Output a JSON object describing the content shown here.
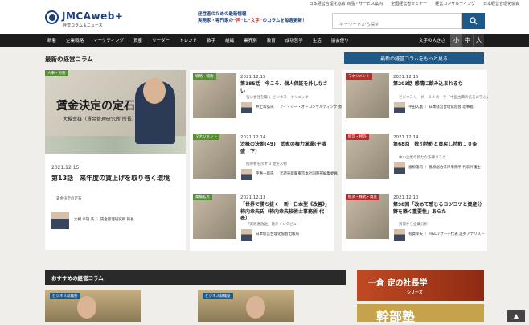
{
  "top_links": [
    "日本経営合理化協会 商品・サービス案内",
    "全国経営者セミナー",
    "経営コンサルティング",
    "日本経営合理化協会"
  ],
  "logo": {
    "main": "JMCAweb+",
    "sub": "経営コラム＆ニュース"
  },
  "tagline": {
    "line1": "経営者のための最新情報",
    "line2a": "実務家・専門家の",
    "line2b": "“声”",
    "line2c": "と",
    "line2d": "“文字”",
    "line2e": "のコラムを毎週更新！"
  },
  "search": {
    "placeholder": "キーワードから探す"
  },
  "nav": [
    "新着",
    "企業戦略",
    "マーケティング",
    "資産",
    "リーダー",
    "トレンド",
    "数字",
    "組織",
    "業界別",
    "教育",
    "成功哲学",
    "生活",
    "協会便り"
  ],
  "text_size": {
    "label": "文字の大きさ",
    "small": "小",
    "medium": "中",
    "large": "大"
  },
  "latest": {
    "title": "最新の経営コラム",
    "more": "最新の経営コラムをもっと見る"
  },
  "featured": {
    "tag": "人事・労務",
    "img_title": "賃金決定の定石",
    "img_sub": "大槻幸雄（賃金管理研究所 所長）",
    "date": "2021.12.15",
    "title": "第13話　来年度の賃上げを取り巻く環境",
    "category": "賃金決定の定石",
    "author": "大槻 幸雄 氏 ｜ 賃金管理研究所 所長"
  },
  "cards": [
    {
      "tag": "戦略・戦術",
      "date": "2021.12.15",
      "title": "第185話　今こそ、個人保証を外しなさい",
      "category": "強い会社を築く ビジネス・クリニック",
      "author": "井上和弘氏 ｜ アイ・シー・オーコンサルティング 会長"
    },
    {
      "tag": "マネジメント",
      "date": "2021.12.15",
      "title": "第203話 感情に飲み込まれるな",
      "category": "ビジネスリーダー 2.0 の一手「中国古典の名言に学ぶ」",
      "author": "平田久磨 ｜ 日本経営合理化協会 理事長"
    },
    {
      "tag": "マネジメント",
      "date": "2021.12.14",
      "title": "渋概の決断(49)　武家の権力掌握(平清盛　下)",
      "category": "指導者を示す 3 歴史人物",
      "author": "宇惠一郎氏 ｜ 元読売新聞東京本社国際部編集委員"
    },
    {
      "tag": "経営・特許",
      "date": "2021.12.14",
      "title": "第68回　数引特約と買戻し特約１０条",
      "category": "中小企業の新たな法律リスク",
      "author": "島根雄司 ｜ 島根総合法律事務所 代表弁護士"
    },
    {
      "tag": "業績拡大",
      "date": "2021.12.13",
      "title": "「世界で勝ち抜く　新・日本型《改善》」柿内幸夫氏（柿内幸夫技術士事務所 代表）",
      "category": "「実践者放送」番外インタビュー",
      "author": "日本経営合理化協会出版局"
    },
    {
      "tag": "経済・株式・資産",
      "date": "2021.12.10",
      "title": "第98回「改めて感じるコツコツと資産分野を築く重要性」あらた",
      "category": "買得から企業分析",
      "author": "有賀幸夫 ｜ H&Lリサーチ代表 証券アナリスト"
    }
  ],
  "recommended": {
    "title": "おすすめの経営コラム",
    "tags": [
      "ビジネス就職塾",
      "ビジネス就職塾"
    ]
  },
  "banners": {
    "b1_title": "一倉 定の社長学",
    "b1_sub": "シリーズ",
    "b2_title": "幹部塾"
  },
  "colors": {
    "accent": "#1d5a8a",
    "nav_bg": "#1c1c1c",
    "logo": "#1c3f7a"
  }
}
